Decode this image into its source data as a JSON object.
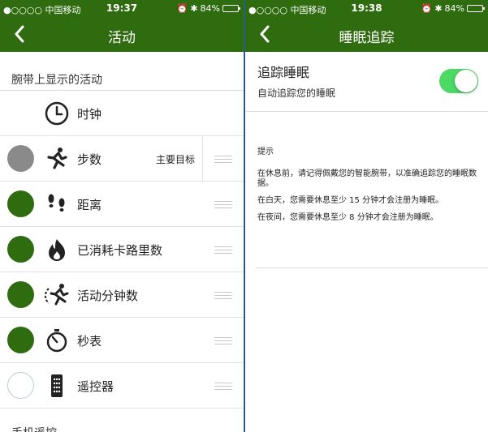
{
  "left": {
    "status": {
      "carrier": "●○○○○ 中国移动",
      "time": "19:37",
      "battery": "84%",
      "battery_level": 0.84
    },
    "nav": {
      "title": "活动"
    },
    "section_title": "腕带上显示的活动",
    "rows": [
      {
        "label": "时钟",
        "icon": "clock-icon"
      },
      {
        "label": "步数",
        "icon": "running-icon",
        "goal": "主要目标",
        "dot": "gray"
      },
      {
        "label": "距离",
        "icon": "footprints-icon",
        "dot": "green"
      },
      {
        "label": "已消耗卡路里数",
        "icon": "flame-icon",
        "dot": "green"
      },
      {
        "label": "活动分钟数",
        "icon": "active-runner-icon",
        "dot": "green"
      },
      {
        "label": "秒表",
        "icon": "stopwatch-icon",
        "dot": "green"
      },
      {
        "label": "遥控器",
        "icon": "remote-icon",
        "dot": "empty"
      }
    ],
    "footer_section": "手机遥控"
  },
  "right": {
    "status": {
      "carrier": "●○○○○ 中国移动",
      "time": "19:38",
      "battery": "84%",
      "battery_level": 0.84
    },
    "nav": {
      "title": "睡眠追踪"
    },
    "toggle": {
      "title": "追踪睡眠",
      "subtitle": "自动追踪您的睡眠",
      "on": true
    },
    "tips": {
      "title": "提示",
      "items": [
        "在休息前，请记得佩戴您的智能腕带，以准确追踪您的睡眠数据。",
        "在白天，您需要休息至少 15 分钟才会注册为睡眠。",
        "在夜间，您需要休息至少 8 分钟才会注册为睡眠。"
      ]
    }
  },
  "colors": {
    "brand_green": "#2f6b0f",
    "switch_on": "#4cd964",
    "dot_gray": "#8a8a8a"
  }
}
